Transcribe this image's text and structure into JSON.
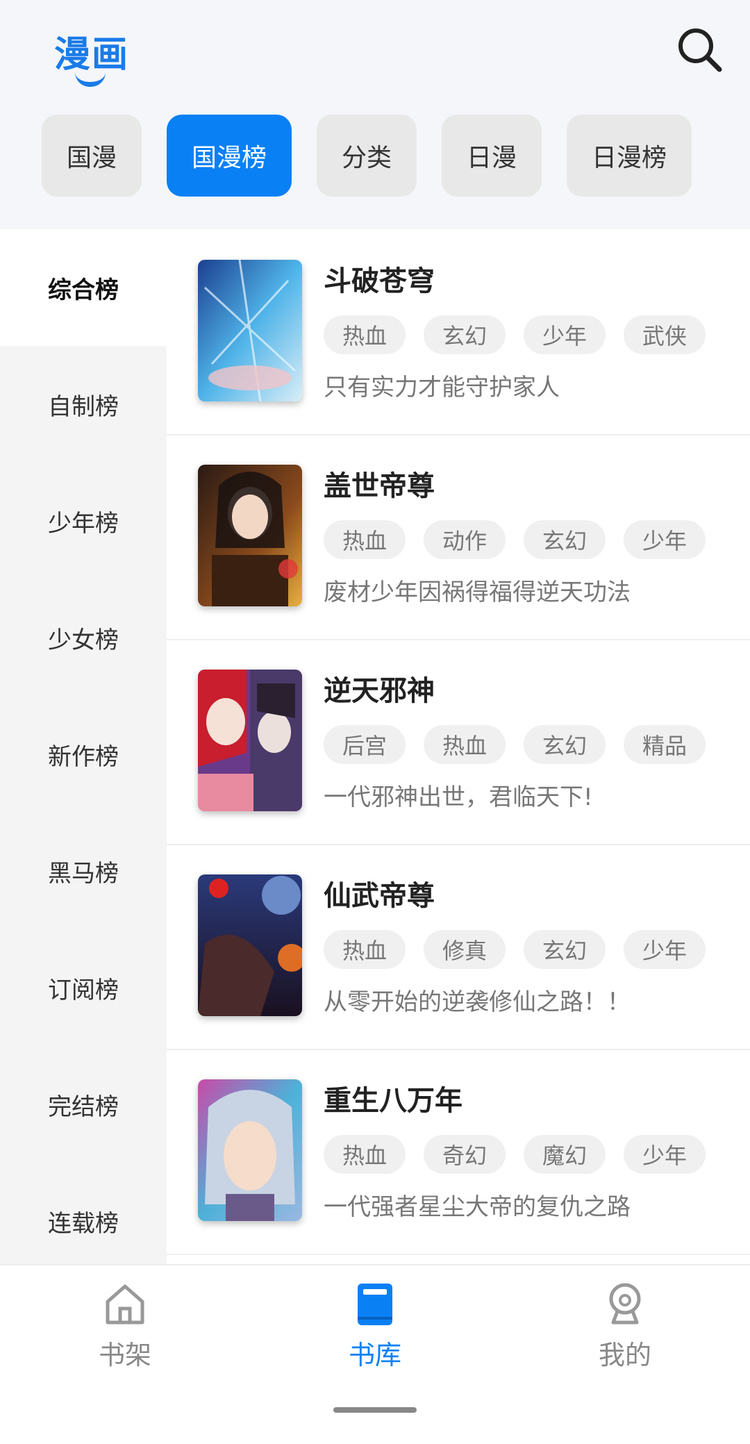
{
  "app": {
    "logo_text": "漫画"
  },
  "tabs": [
    {
      "label": "国漫",
      "active": false
    },
    {
      "label": "国漫榜",
      "active": true
    },
    {
      "label": "分类",
      "active": false
    },
    {
      "label": "日漫",
      "active": false
    },
    {
      "label": "日漫榜",
      "active": false
    }
  ],
  "sidebar": {
    "items": [
      {
        "label": "综合榜"
      },
      {
        "label": "自制榜"
      },
      {
        "label": "少年榜"
      },
      {
        "label": "少女榜"
      },
      {
        "label": "新作榜"
      },
      {
        "label": "黑马榜"
      },
      {
        "label": "订阅榜"
      },
      {
        "label": "完结榜"
      },
      {
        "label": "连载榜"
      }
    ]
  },
  "comics": [
    {
      "title": "斗破苍穹",
      "tags": [
        "热血",
        "玄幻",
        "少年",
        "武侠"
      ],
      "desc": "只有实力才能守护家人"
    },
    {
      "title": "盖世帝尊",
      "tags": [
        "热血",
        "动作",
        "玄幻",
        "少年"
      ],
      "desc": "废材少年因祸得福得逆天功法"
    },
    {
      "title": "逆天邪神",
      "tags": [
        "后宫",
        "热血",
        "玄幻",
        "精品"
      ],
      "desc": "一代邪神出世，君临天下!"
    },
    {
      "title": "仙武帝尊",
      "tags": [
        "热血",
        "修真",
        "玄幻",
        "少年"
      ],
      "desc": "从零开始的逆袭修仙之路！！"
    },
    {
      "title": "重生八万年",
      "tags": [
        "热血",
        "奇幻",
        "魔幻",
        "少年"
      ],
      "desc": "一代强者星尘大帝的复仇之路"
    }
  ],
  "bottom_nav": [
    {
      "label": "书架",
      "icon": "home-icon"
    },
    {
      "label": "书库",
      "icon": "book-icon"
    },
    {
      "label": "我的",
      "icon": "profile-icon"
    }
  ],
  "colors": {
    "accent": "#0a80f5",
    "logo": "#1a7be8"
  }
}
